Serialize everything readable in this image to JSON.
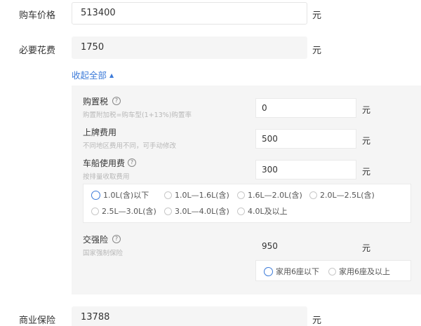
{
  "car_price": {
    "label": "购车价格",
    "value": "513400",
    "unit": "元"
  },
  "required_costs": {
    "label": "必要花费",
    "value": "1750",
    "unit": "元"
  },
  "collapse_toggle": {
    "label": "收起全部",
    "arrow": "▲"
  },
  "purchase_tax": {
    "title": "购置税",
    "sub": "购置附加税=购车型(1+13%)购置率",
    "value": "0",
    "unit": "元"
  },
  "registration_fee": {
    "title": "上牌费用",
    "sub": "不同地区费用不同，可手动修改",
    "value": "500",
    "unit": "元"
  },
  "vehicle_vessel_tax": {
    "title": "车船使用费",
    "sub": "按排量收取费用",
    "value": "300",
    "unit": "元",
    "options": [
      "1.0L(含)以下",
      "1.0L—1.6L(含)",
      "1.6L—2.0L(含)",
      "2.0L—2.5L(含)",
      "2.5L—3.0L(含)",
      "3.0L—4.0L(含)",
      "4.0L及以上"
    ],
    "selected_index": 0
  },
  "compulsory_insurance": {
    "title": "交强险",
    "sub": "国家强制保险",
    "value": "950",
    "unit": "元",
    "options": [
      "家用6座以下",
      "家用6座及以上"
    ],
    "selected_index": 0
  },
  "commercial_insurance": {
    "label": "商业保险",
    "value": "13788",
    "unit": "元"
  },
  "icons": {
    "help": "question-circle-icon",
    "collapse": "caret-up-icon"
  },
  "colors": {
    "accent": "#3d7bd9",
    "panel_bg": "#f5f5f5"
  }
}
